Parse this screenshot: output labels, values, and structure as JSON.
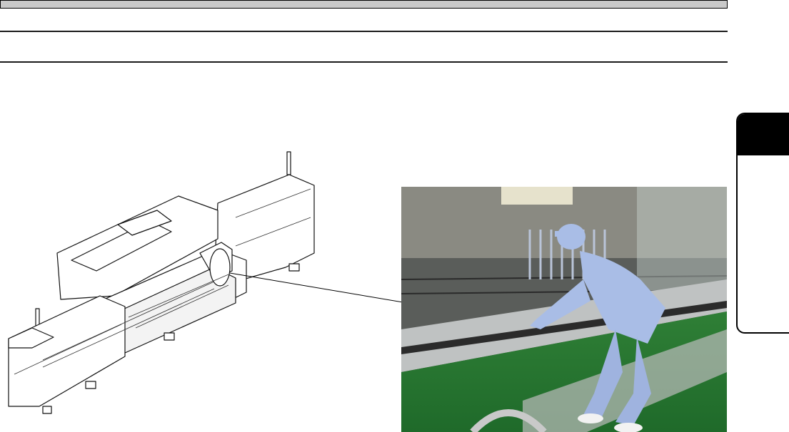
{
  "page": {
    "header": {
      "bar": "",
      "subtitle": ""
    },
    "chapter_tab": {
      "label": ""
    }
  },
  "figure": {
    "illustration": "machine-line-drawing",
    "photo": "operator-photo"
  },
  "colors": {
    "header_bar": "#c9c9c9",
    "tab": "#000000",
    "floor": "#2f8a3a",
    "uniform": "#a9bde6"
  }
}
